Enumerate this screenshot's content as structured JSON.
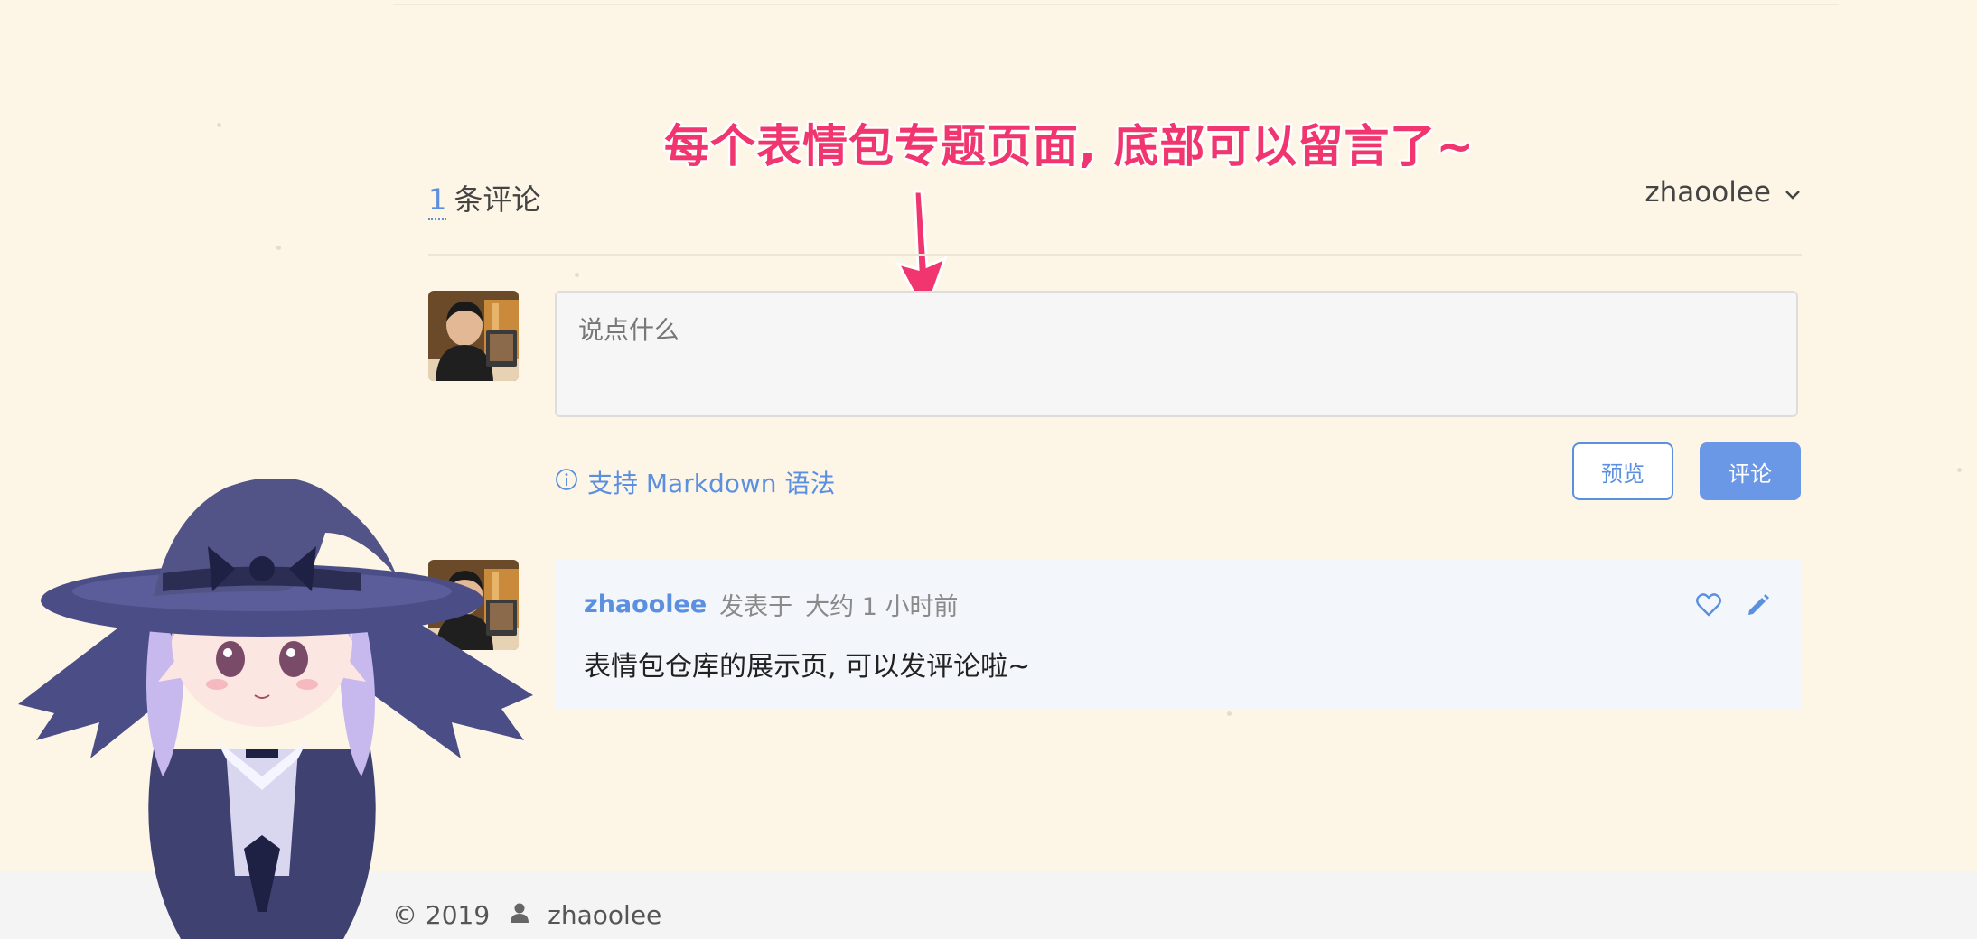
{
  "annotation": {
    "text": "每个表情包专题页面, 底部可以留言了~"
  },
  "comments_header": {
    "count": "1",
    "count_label": "条评论",
    "username": "zhaoolee"
  },
  "editor": {
    "placeholder": "说点什么"
  },
  "markdown_hint": {
    "text": "支持 Markdown 语法"
  },
  "buttons": {
    "preview": "预览",
    "submit": "评论"
  },
  "comment": {
    "author": "zhaoolee",
    "posted_label": "发表于",
    "time": "大约 1 小时前",
    "body": "表情包仓库的展示页, 可以发评论啦~"
  },
  "footer": {
    "copyright": "© 2019",
    "author": "zhaoolee"
  },
  "colors": {
    "background": "#fdf6e7",
    "accent": "#5b8fe0",
    "annotation": "#f0356f",
    "card": "#f3f6fb"
  },
  "icons": [
    "chevron-down-icon",
    "info-icon",
    "heart-icon",
    "pencil-icon",
    "user-icon"
  ]
}
